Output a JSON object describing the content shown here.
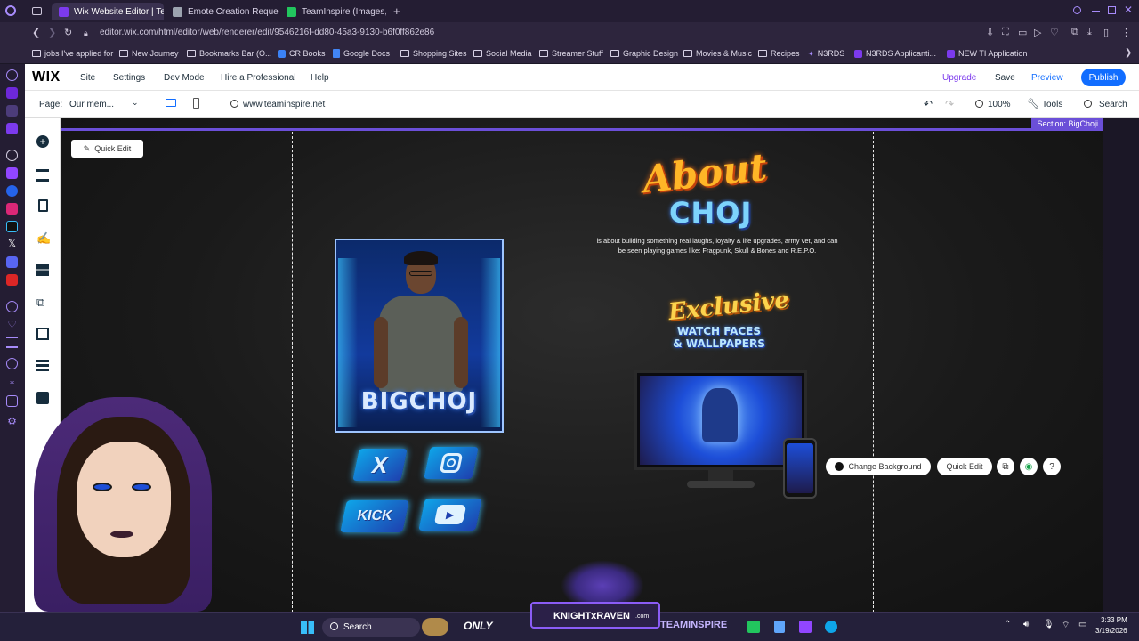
{
  "browser": {
    "tabs": [
      {
        "label": "Wix Website Editor | Team",
        "active": true,
        "favicon_color": "#7c3aed"
      },
      {
        "label": "Emote Creation Request",
        "active": false,
        "favicon_color": "#9ca3af"
      },
      {
        "label": "TeamInspire (Images, Post",
        "active": false,
        "favicon_color": "#22c55e"
      }
    ],
    "new_tab_glyph": "+",
    "url": "editor.wix.com/html/editor/web/renderer/edit/9546216f-dd80-45a3-9130-b6f0ff862e86",
    "bookmarks": [
      {
        "label": "jobs I've applied for",
        "icon": "folder-icon"
      },
      {
        "label": "New Journey",
        "icon": "folder-icon"
      },
      {
        "label": "Bookmarks Bar (O...",
        "icon": "folder-icon"
      },
      {
        "label": "CR Books",
        "icon": "cr-icon"
      },
      {
        "label": "Google Docs",
        "icon": "docs-icon"
      },
      {
        "label": "Shopping Sites",
        "icon": "folder-icon"
      },
      {
        "label": "Social Media",
        "icon": "folder-icon"
      },
      {
        "label": "Streamer Stuff",
        "icon": "folder-icon"
      },
      {
        "label": "Graphic Design",
        "icon": "folder-icon"
      },
      {
        "label": "Movies & Music",
        "icon": "folder-icon"
      },
      {
        "label": "Recipes",
        "icon": "folder-icon"
      },
      {
        "label": "N3RDS",
        "icon": "n3rds-icon"
      },
      {
        "label": "N3RDS Applicanti...",
        "icon": "app-icon"
      },
      {
        "label": "NEW TI Application",
        "icon": "app-icon"
      }
    ]
  },
  "wix": {
    "logo": "WIX",
    "menu": [
      "Site",
      "Settings",
      "Dev Mode",
      "Hire a Professional",
      "Help"
    ],
    "upgrade": "Upgrade",
    "save": "Save",
    "preview": "Preview",
    "publish": "Publish",
    "page_label": "Page:",
    "page_value": "Our mem...",
    "domain": "www.teaminspire.net",
    "zoom": "100%",
    "tools": "Tools",
    "search": "Search",
    "section_tag": "Section: BigChoji",
    "quick_edit": "Quick Edit",
    "change_background": "Change Background",
    "quick_edit_2": "Quick Edit"
  },
  "canvas": {
    "about_title_1": "About",
    "about_title_2": "CHOJ",
    "about_text": "is about building something real  laughs, loyalty & life upgrades, army vet, and can be seen playing games like: Fragpunk, Skull & Bones and R.E.P.O.",
    "exclusive_1": "Exclusive",
    "exclusive_2": "WATCH FACES",
    "exclusive_3": "& WALLPAPERS",
    "profile_name": "BIGCHOJ",
    "social": [
      "X",
      "Instagram",
      "KICK",
      "YouTube"
    ]
  },
  "taskbar": {
    "search": "Search",
    "banner": "KNIGHTxRAVEN",
    "banner_suffix": ".com",
    "only_label": "ONLY",
    "teaminspire": "TEAMINSPIRE",
    "time": "3:33 PM",
    "date": "3/19/2026"
  },
  "colors": {
    "accent": "#6b4fd8",
    "publish": "#116dff",
    "upgrade": "#7c3aed",
    "preview": "#116dff"
  }
}
